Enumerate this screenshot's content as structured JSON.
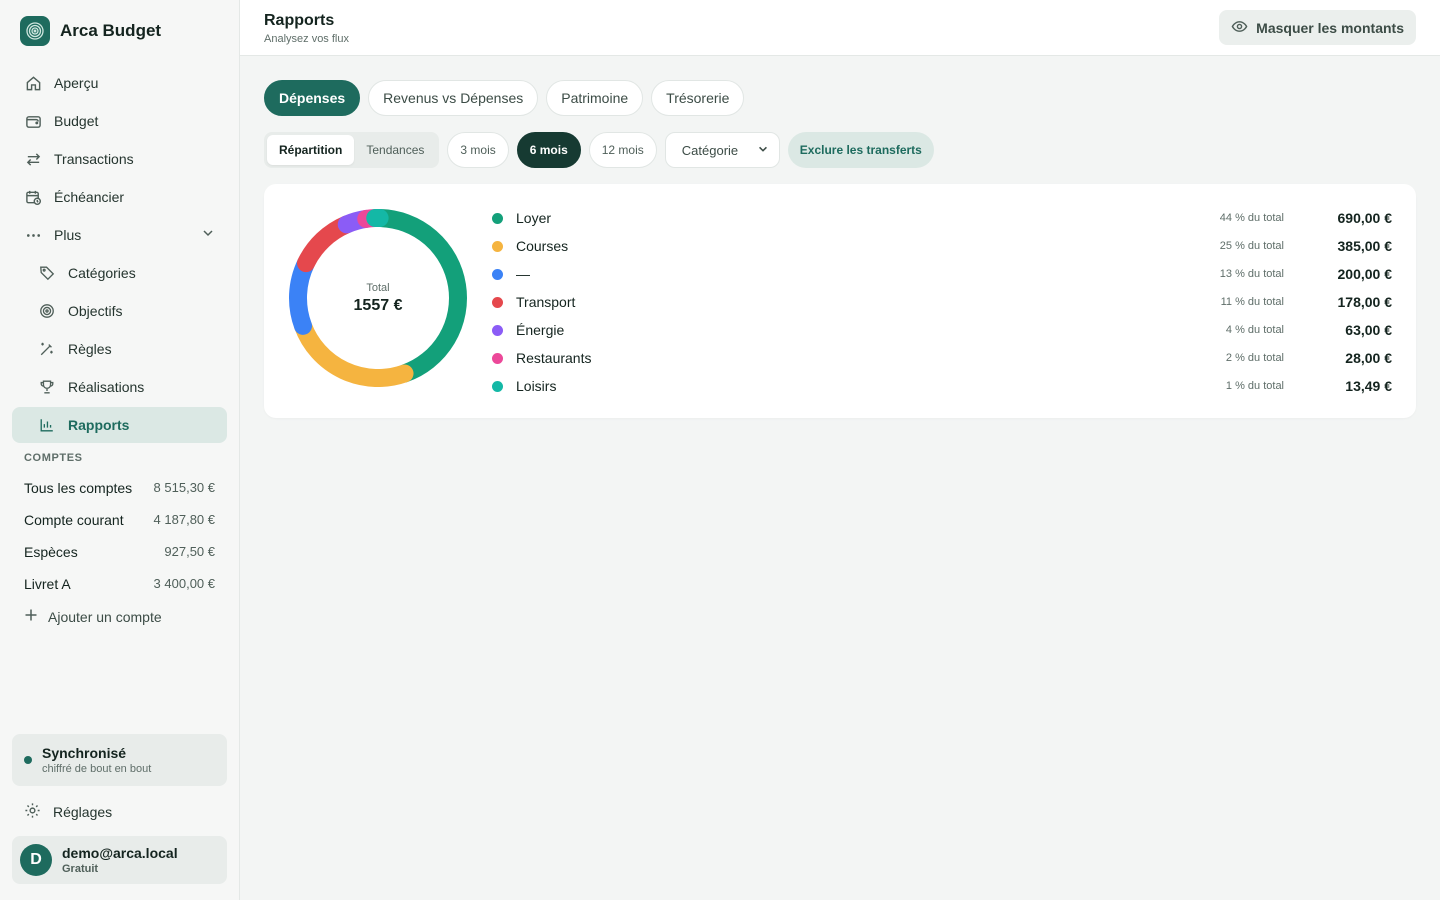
{
  "app": {
    "name": "Arca Budget"
  },
  "nav": {
    "items": [
      {
        "label": "Aperçu",
        "icon": "home-icon"
      },
      {
        "label": "Budget",
        "icon": "wallet-icon"
      },
      {
        "label": "Transactions",
        "icon": "transfer-icon"
      },
      {
        "label": "Échéancier",
        "icon": "calendar-clock-icon"
      },
      {
        "label": "Plus",
        "icon": "more-icon"
      }
    ],
    "sub_items": [
      {
        "label": "Catégories",
        "icon": "tag-icon"
      },
      {
        "label": "Objectifs",
        "icon": "target-icon"
      },
      {
        "label": "Règles",
        "icon": "wand-icon"
      },
      {
        "label": "Réalisations",
        "icon": "trophy-icon"
      },
      {
        "label": "Rapports",
        "icon": "bar-chart-icon",
        "active": true
      }
    ]
  },
  "accounts": {
    "title": "COMPTES",
    "list": [
      {
        "name": "Tous les comptes",
        "balance": "8 515,30 €"
      },
      {
        "name": "Compte courant",
        "balance": "4 187,80 €"
      },
      {
        "name": "Espèces",
        "balance": "927,50 €"
      },
      {
        "name": "Livret A",
        "balance": "3 400,00 €"
      }
    ],
    "add_label": "Ajouter un compte"
  },
  "sync": {
    "status": "Synchronisé",
    "detail": "chiffré de bout en bout"
  },
  "settings_label": "Réglages",
  "user": {
    "initial": "D",
    "email": "demo@arca.local",
    "plan": "Gratuit"
  },
  "header": {
    "title": "Rapports",
    "subtitle": "Analysez vos flux",
    "hide_button": "Masquer les montants"
  },
  "tabs": [
    {
      "label": "Dépenses",
      "active": true
    },
    {
      "label": "Revenus vs Dépenses"
    },
    {
      "label": "Patrimoine"
    },
    {
      "label": "Trésorerie"
    }
  ],
  "filters": {
    "view": [
      {
        "label": "Répartition",
        "active": true
      },
      {
        "label": "Tendances"
      }
    ],
    "periods": [
      {
        "label": "3 mois"
      },
      {
        "label": "6 mois",
        "active": true
      },
      {
        "label": "12 mois"
      }
    ],
    "group_by": "Catégorie",
    "exclude_transfers": "Exclure les transferts"
  },
  "chart_data": {
    "type": "pie",
    "center_label": "Total",
    "total": "1557 €",
    "slices": [
      {
        "label": "Loyer",
        "value": 690.0,
        "percent": "44 % du total",
        "amount": "690,00 €",
        "color": "#13a07a"
      },
      {
        "label": "Courses",
        "value": 385.0,
        "percent": "25 % du total",
        "amount": "385,00 €",
        "color": "#f5b440"
      },
      {
        "label": "—",
        "value": 200.0,
        "percent": "13 % du total",
        "amount": "200,00 €",
        "color": "#3b82f6"
      },
      {
        "label": "Transport",
        "value": 178.0,
        "percent": "11 % du total",
        "amount": "178,00 €",
        "color": "#e5484d"
      },
      {
        "label": "Énergie",
        "value": 63.0,
        "percent": "4 % du total",
        "amount": "63,00 €",
        "color": "#8b5cf6"
      },
      {
        "label": "Restaurants",
        "value": 28.0,
        "percent": "2 % du total",
        "amount": "28,00 €",
        "color": "#ec4899"
      },
      {
        "label": "Loisirs",
        "value": 13.49,
        "percent": "1 % du total",
        "amount": "13,49 €",
        "color": "#14b8a6"
      }
    ]
  }
}
